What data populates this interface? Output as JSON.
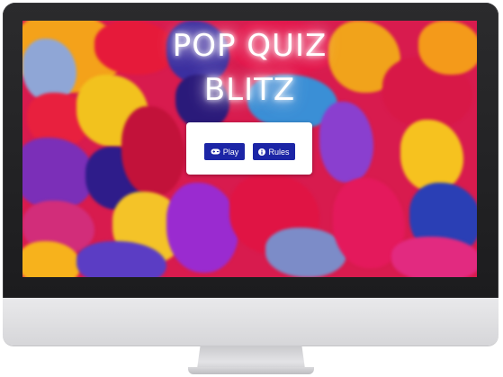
{
  "app": {
    "title_line1": "POP QUIZ",
    "title_line2": "BLITZ"
  },
  "menu": {
    "play_label": "Play",
    "rules_label": "Rules",
    "play_icon": "gamepad-icon",
    "rules_icon": "info-circle-icon"
  },
  "colors": {
    "button_bg": "#1c25a6",
    "card_bg": "#ffffff",
    "title_glow": "#ffffff",
    "bezel": "#1c1c1e"
  }
}
